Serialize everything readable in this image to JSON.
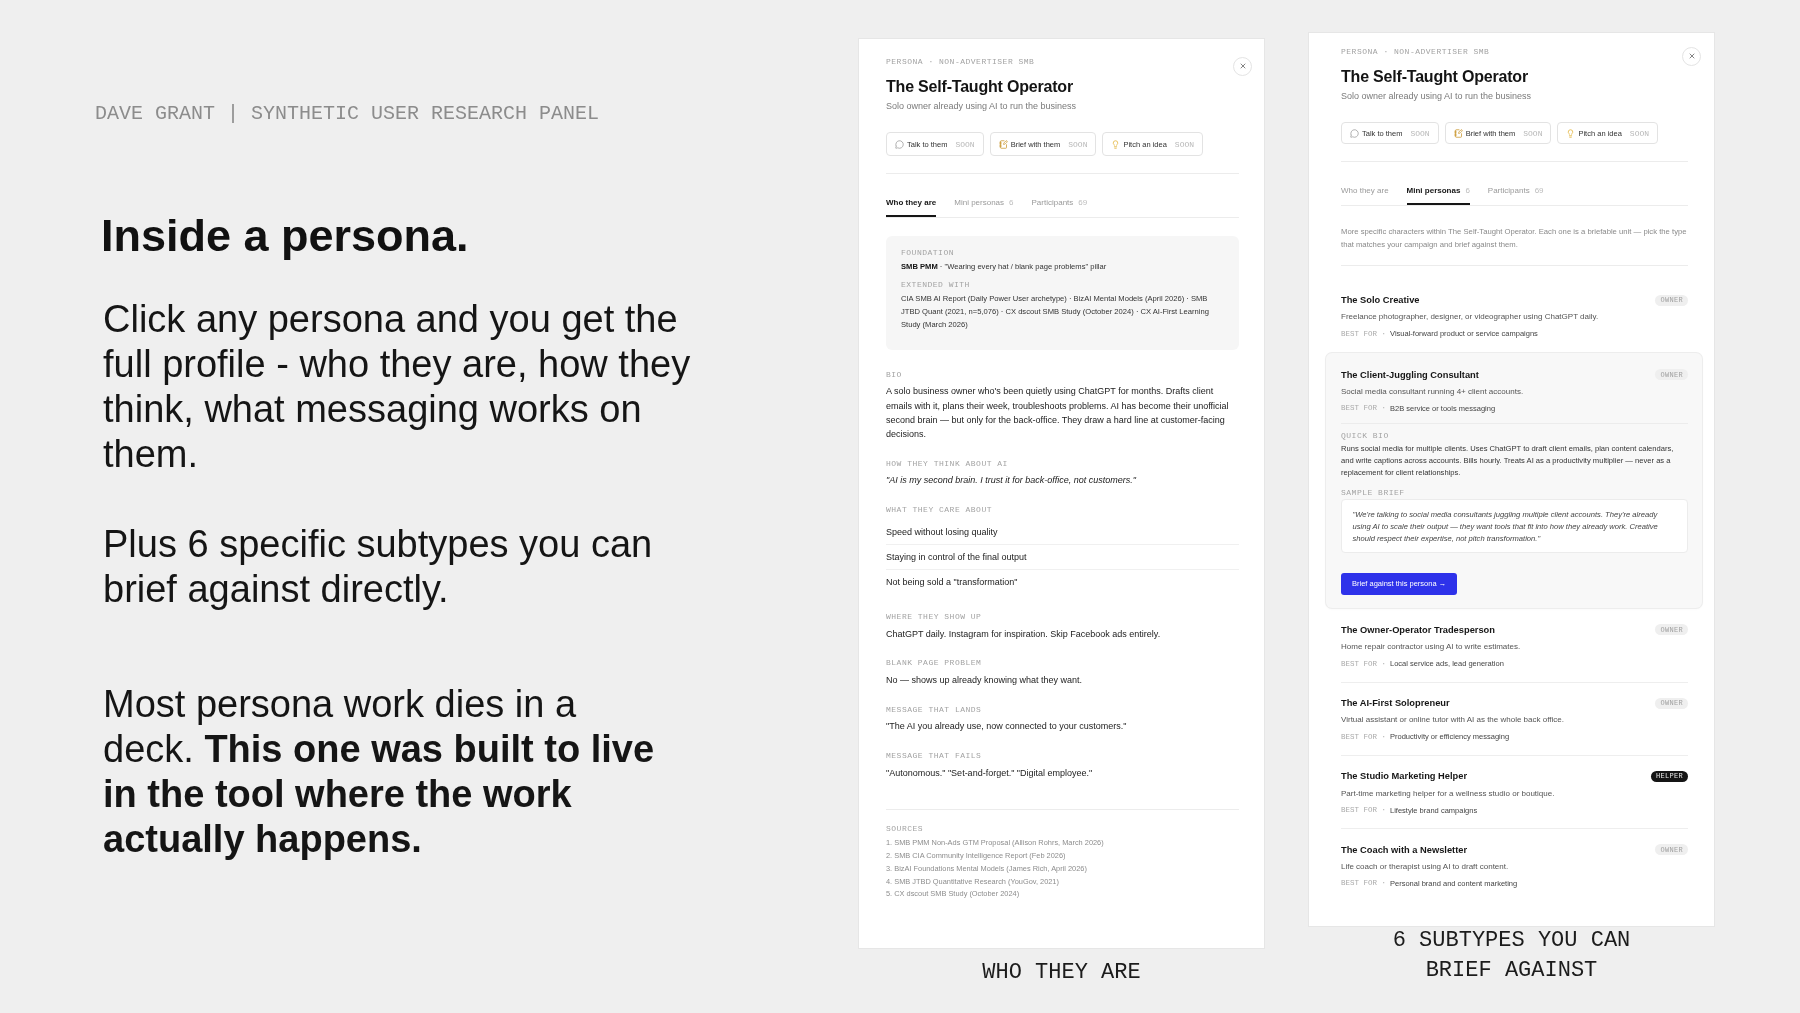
{
  "header": "DAVE GRANT | SYNTHETIC USER RESEARCH PANEL",
  "headline": "Inside a persona.",
  "paragraphs": [
    "Click any persona and you get the full profile - who they are, how they think, what messaging works on them.",
    "Plus 6 specific subtypes you can brief against directly.",
    "Most persona work dies in a deck. **This one was built to live in the tool where the work actually happens.**"
  ],
  "panels": [
    {
      "kind": "profile",
      "eyebrow": "PERSONA · NON-ADVERTISER SMB",
      "title": "The Self-Taught Operator",
      "subtitle": "Solo owner already using AI to run the business",
      "actions": [
        {
          "label": "Talk to them",
          "hint": "SOON"
        },
        {
          "label": "Brief with them",
          "hint": "SOON"
        },
        {
          "label": "Pitch an idea",
          "hint": "SOON"
        }
      ],
      "tabs": [
        {
          "label": "Who they are",
          "selected": true
        },
        {
          "label": "Mini personas",
          "count": "6",
          "selected": false
        },
        {
          "label": "Participants",
          "count": "69",
          "selected": false
        }
      ],
      "foundation": [
        {
          "label": "FOUNDATION",
          "text": "**SMB PMM** · \"Wearing every hat / blank page problems\" pillar"
        },
        {
          "label": "EXTENDED WITH",
          "text": "CIA SMB AI Report (Daily Power User archetype) · BizAI Mental Models (April 2026) · SMB JTBD Quant (2021, n=5,076) · CX dscout SMB Study (October 2024) · CX AI-First Learning Study (March 2026)"
        }
      ],
      "sections": [
        {
          "kind": "text",
          "label": "BIO",
          "text": "A solo business owner who's been quietly using ChatGPT for months. Drafts client emails with it, plans their week, troubleshoots problems. AI has become their unofficial second brain — but only for the back-office. They draw a hard line at customer-facing decisions."
        },
        {
          "kind": "quote",
          "label": "HOW THEY THINK ABOUT AI",
          "text": "\"AI is my second brain. I trust it for back-office, not customers.\""
        },
        {
          "kind": "list",
          "label": "WHAT THEY CARE ABOUT",
          "items": [
            "Speed without losing quality",
            "Staying in control of the final output",
            "Not being sold a \"transformation\""
          ]
        },
        {
          "kind": "text",
          "label": "WHERE THEY SHOW UP",
          "text": "ChatGPT daily. Instagram for inspiration. Skip Facebook ads entirely."
        },
        {
          "kind": "text",
          "label": "BLANK PAGE PROBLEM",
          "text": "No — shows up already knowing what they want."
        },
        {
          "kind": "text",
          "label": "MESSAGE THAT LANDS",
          "text": "\"The AI you already use, now connected to your customers.\""
        },
        {
          "kind": "text",
          "label": "MESSAGE THAT FAILS",
          "text": "\"Autonomous.\" \"Set-and-forget.\" \"Digital employee.\""
        }
      ],
      "sources": {
        "label": "SOURCES",
        "items": [
          "1. SMB PMM Non-Ads GTM Proposal (Allison Rohrs, March 2026)",
          "2. SMB CIA Community Intelligence Report (Feb 2026)",
          "3. BizAI Foundations Mental Models (James Rich, April 2026)",
          "4. SMB JTBD Quantitative Research (YouGov, 2021)",
          "5. CX dscout SMB Study (October 2024)"
        ]
      },
      "caption": "WHO THEY ARE"
    },
    {
      "kind": "mini_personas",
      "eyebrow": "PERSONA · NON-ADVERTISER SMB",
      "title": "The Self-Taught Operator",
      "subtitle": "Solo owner already using AI to run the business",
      "actions": [
        {
          "label": "Talk to them",
          "hint": "SOON"
        },
        {
          "label": "Brief with them",
          "hint": "SOON"
        },
        {
          "label": "Pitch an idea",
          "hint": "SOON"
        }
      ],
      "tabs": [
        {
          "label": "Who they are",
          "selected": false
        },
        {
          "label": "Mini personas",
          "count": "6",
          "selected": true
        },
        {
          "label": "Participants",
          "count": "69",
          "selected": false
        }
      ],
      "intro": "More specific characters within The Self-Taught Operator. Each one is a briefable unit — pick the type that matches your campaign and brief against them.",
      "personas": [
        {
          "name": "The Solo Creative",
          "badge": "OWNER",
          "badge_filled": false,
          "description": "Freelance photographer, designer, or videographer using ChatGPT daily.",
          "best_for_label": "BEST FOR ·",
          "best_for": "Visual-forward product or service campaigns",
          "expanded": false
        },
        {
          "name": "The Client-Juggling Consultant",
          "badge": "OWNER",
          "badge_filled": false,
          "description": "Social media consultant running 4+ client accounts.",
          "best_for_label": "BEST FOR ·",
          "best_for": "B2B service or tools messaging",
          "expanded": true,
          "quick_bio_label": "QUICK BIO",
          "quick_bio": "Runs social media for multiple clients. Uses ChatGPT to draft client emails, plan content calendars, and write captions across accounts. Bills hourly. Treats AI as a productivity multiplier — never as a replacement for client relationships.",
          "sample_brief_label": "SAMPLE BRIEF",
          "sample_brief": "\"We're talking to social media consultants juggling multiple client accounts. They're already using AI to scale their output — they want tools that fit into how they already work. Creative should respect their expertise, not pitch transformation.\"",
          "button": "Brief against this persona →"
        },
        {
          "name": "The Owner-Operator Tradesperson",
          "badge": "OWNER",
          "badge_filled": false,
          "description": "Home repair contractor using AI to write estimates.",
          "best_for_label": "BEST FOR ·",
          "best_for": "Local service ads, lead generation",
          "expanded": false
        },
        {
          "name": "The AI-First Solopreneur",
          "badge": "OWNER",
          "badge_filled": false,
          "description": "Virtual assistant or online tutor with AI as the whole back office.",
          "best_for_label": "BEST FOR ·",
          "best_for": "Productivity or efficiency messaging",
          "expanded": false
        },
        {
          "name": "The Studio Marketing Helper",
          "badge": "HELPER",
          "badge_filled": true,
          "description": "Part-time marketing helper for a wellness studio or boutique.",
          "best_for_label": "BEST FOR ·",
          "best_for": "Lifestyle brand campaigns",
          "expanded": false
        },
        {
          "name": "The Coach with a Newsletter",
          "badge": "OWNER",
          "badge_filled": false,
          "description": "Life coach or therapist using AI to draft content.",
          "best_for_label": "BEST FOR ·",
          "best_for": "Personal brand and content marketing",
          "expanded": false
        }
      ],
      "caption": "6 SUBTYPES YOU CAN BRIEF AGAINST"
    }
  ]
}
